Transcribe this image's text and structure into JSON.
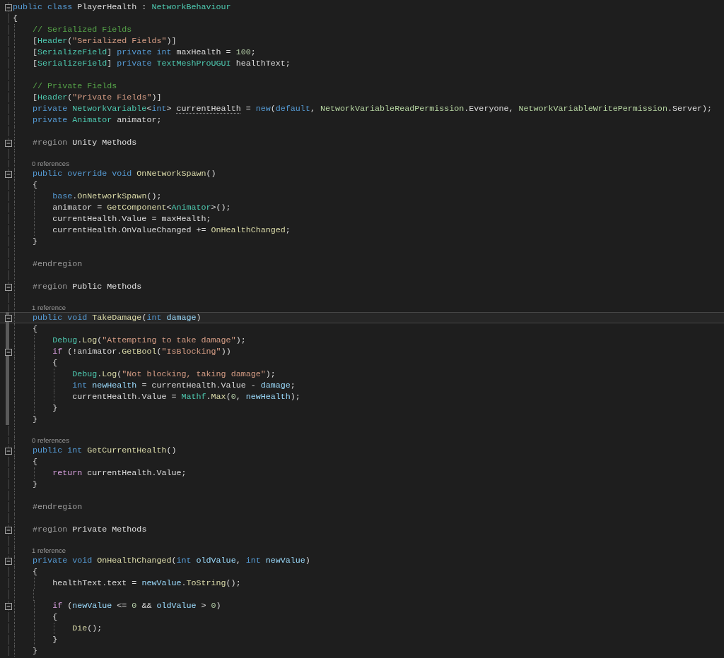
{
  "editor": {
    "lines": [
      {
        "kind": "code",
        "selected": false,
        "foldable": true,
        "changed": false,
        "tokens": [
          {
            "kind": "keyword",
            "text": "public class"
          },
          {
            "kind": "plain",
            "text": " PlayerHealth : "
          },
          {
            "kind": "type",
            "text": "NetworkBehaviour"
          }
        ]
      },
      {
        "kind": "code",
        "selected": false,
        "foldable": false,
        "changed": false,
        "tokens": [
          {
            "kind": "plain",
            "text": "{"
          }
        ]
      },
      {
        "kind": "code",
        "selected": false,
        "foldable": false,
        "changed": false,
        "tokens": [
          {
            "kind": "comment",
            "text": "    // Serialized Fields"
          }
        ]
      },
      {
        "kind": "code",
        "selected": false,
        "foldable": false,
        "changed": false,
        "tokens": [
          {
            "kind": "plain",
            "text": "    ["
          },
          {
            "kind": "type",
            "text": "Header"
          },
          {
            "kind": "plain",
            "text": "("
          },
          {
            "kind": "string",
            "text": "\"Serialized Fields\""
          },
          {
            "kind": "plain",
            "text": ")]"
          }
        ]
      },
      {
        "kind": "code",
        "selected": false,
        "foldable": false,
        "changed": false,
        "tokens": [
          {
            "kind": "plain",
            "text": "    ["
          },
          {
            "kind": "type",
            "text": "SerializeField"
          },
          {
            "kind": "plain",
            "text": "] "
          },
          {
            "kind": "keyword",
            "text": "private int"
          },
          {
            "kind": "plain",
            "text": " maxHealth = "
          },
          {
            "kind": "number",
            "text": "100"
          },
          {
            "kind": "plain",
            "text": ";"
          }
        ]
      },
      {
        "kind": "code",
        "selected": false,
        "foldable": false,
        "changed": false,
        "tokens": [
          {
            "kind": "plain",
            "text": "    ["
          },
          {
            "kind": "type",
            "text": "SerializeField"
          },
          {
            "kind": "plain",
            "text": "] "
          },
          {
            "kind": "keyword",
            "text": "private "
          },
          {
            "kind": "type",
            "text": "TextMeshProUGUI"
          },
          {
            "kind": "plain",
            "text": " healthText;"
          }
        ]
      },
      {
        "kind": "blank",
        "selected": false,
        "foldable": false,
        "changed": false
      },
      {
        "kind": "code",
        "selected": false,
        "foldable": false,
        "changed": false,
        "tokens": [
          {
            "kind": "comment",
            "text": "    // Private Fields"
          }
        ]
      },
      {
        "kind": "code",
        "selected": false,
        "foldable": false,
        "changed": false,
        "tokens": [
          {
            "kind": "plain",
            "text": "    ["
          },
          {
            "kind": "type",
            "text": "Header"
          },
          {
            "kind": "plain",
            "text": "("
          },
          {
            "kind": "string",
            "text": "\"Private Fields\""
          },
          {
            "kind": "plain",
            "text": ")]"
          }
        ]
      },
      {
        "kind": "code",
        "selected": false,
        "foldable": false,
        "changed": false,
        "tokens": [
          {
            "kind": "keyword",
            "text": "    private "
          },
          {
            "kind": "type",
            "text": "NetworkVariable"
          },
          {
            "kind": "plain",
            "text": "<"
          },
          {
            "kind": "keyword",
            "text": "int"
          },
          {
            "kind": "plain",
            "text": "> "
          },
          {
            "kind": "suggested",
            "text": "currentHealth"
          },
          {
            "kind": "plain",
            "text": " = "
          },
          {
            "kind": "keyword",
            "text": "new"
          },
          {
            "kind": "plain",
            "text": "("
          },
          {
            "kind": "keyword",
            "text": "default"
          },
          {
            "kind": "plain",
            "text": ", "
          },
          {
            "kind": "enum",
            "text": "NetworkVariableReadPermission"
          },
          {
            "kind": "plain",
            "text": ".Everyone, "
          },
          {
            "kind": "enum",
            "text": "NetworkVariableWritePermission"
          },
          {
            "kind": "plain",
            "text": ".Server);"
          }
        ]
      },
      {
        "kind": "code",
        "selected": false,
        "foldable": false,
        "changed": false,
        "tokens": [
          {
            "kind": "keyword",
            "text": "    private "
          },
          {
            "kind": "type",
            "text": "Animator"
          },
          {
            "kind": "plain",
            "text": " animator;"
          }
        ]
      },
      {
        "kind": "blank",
        "selected": false,
        "foldable": false,
        "changed": false
      },
      {
        "kind": "code",
        "selected": false,
        "foldable": true,
        "changed": false,
        "tokens": [
          {
            "kind": "preprocessor",
            "text": "    #region"
          },
          {
            "kind": "region",
            "text": " Unity Methods"
          }
        ]
      },
      {
        "kind": "blank",
        "selected": false,
        "foldable": false,
        "changed": false
      },
      {
        "kind": "codelens",
        "selected": false,
        "foldable": false,
        "changed": false,
        "text": "0 references"
      },
      {
        "kind": "code",
        "selected": false,
        "foldable": true,
        "changed": false,
        "tokens": [
          {
            "kind": "keyword",
            "text": "    public override void"
          },
          {
            "kind": "method",
            "text": " OnNetworkSpawn"
          },
          {
            "kind": "plain",
            "text": "()"
          }
        ]
      },
      {
        "kind": "code",
        "selected": false,
        "foldable": false,
        "changed": false,
        "tokens": [
          {
            "kind": "plain",
            "text": "    {"
          }
        ]
      },
      {
        "kind": "code",
        "selected": false,
        "foldable": false,
        "changed": false,
        "tokens": [
          {
            "kind": "keyword",
            "text": "        base"
          },
          {
            "kind": "plain",
            "text": "."
          },
          {
            "kind": "method",
            "text": "OnNetworkSpawn"
          },
          {
            "kind": "plain",
            "text": "();"
          }
        ]
      },
      {
        "kind": "code",
        "selected": false,
        "foldable": false,
        "changed": false,
        "tokens": [
          {
            "kind": "plain",
            "text": "        animator = "
          },
          {
            "kind": "method",
            "text": "GetComponent"
          },
          {
            "kind": "plain",
            "text": "<"
          },
          {
            "kind": "type",
            "text": "Animator"
          },
          {
            "kind": "plain",
            "text": ">();"
          }
        ]
      },
      {
        "kind": "code",
        "selected": false,
        "foldable": false,
        "changed": false,
        "tokens": [
          {
            "kind": "plain",
            "text": "        currentHealth.Value = maxHealth;"
          }
        ]
      },
      {
        "kind": "code",
        "selected": false,
        "foldable": false,
        "changed": false,
        "tokens": [
          {
            "kind": "plain",
            "text": "        currentHealth.OnValueChanged += "
          },
          {
            "kind": "method",
            "text": "OnHealthChanged"
          },
          {
            "kind": "plain",
            "text": ";"
          }
        ]
      },
      {
        "kind": "code",
        "selected": false,
        "foldable": false,
        "changed": false,
        "tokens": [
          {
            "kind": "plain",
            "text": "    }"
          }
        ]
      },
      {
        "kind": "blank",
        "selected": false,
        "foldable": false,
        "changed": false
      },
      {
        "kind": "code",
        "selected": false,
        "foldable": false,
        "changed": false,
        "tokens": [
          {
            "kind": "preprocessor",
            "text": "    #endregion"
          }
        ]
      },
      {
        "kind": "blank",
        "selected": false,
        "foldable": false,
        "changed": false
      },
      {
        "kind": "code",
        "selected": false,
        "foldable": true,
        "changed": false,
        "tokens": [
          {
            "kind": "preprocessor",
            "text": "    #region"
          },
          {
            "kind": "region",
            "text": " Public Methods"
          }
        ]
      },
      {
        "kind": "blank",
        "selected": false,
        "foldable": false,
        "changed": false
      },
      {
        "kind": "codelens",
        "selected": false,
        "foldable": false,
        "changed": false,
        "text": "1 reference"
      },
      {
        "kind": "code",
        "selected": true,
        "foldable": true,
        "changed": true,
        "tokens": [
          {
            "kind": "keyword",
            "text": "    public void"
          },
          {
            "kind": "method",
            "text": " TakeDamage"
          },
          {
            "kind": "plain",
            "text": "("
          },
          {
            "kind": "keyword",
            "text": "int "
          },
          {
            "kind": "variable",
            "text": "damage"
          },
          {
            "kind": "plain",
            "text": ")"
          }
        ]
      },
      {
        "kind": "code",
        "selected": false,
        "foldable": false,
        "changed": true,
        "tokens": [
          {
            "kind": "plain",
            "text": "    {"
          }
        ]
      },
      {
        "kind": "code",
        "selected": false,
        "foldable": false,
        "changed": true,
        "tokens": [
          {
            "kind": "type",
            "text": "        Debug"
          },
          {
            "kind": "plain",
            "text": "."
          },
          {
            "kind": "method",
            "text": "Log"
          },
          {
            "kind": "plain",
            "text": "("
          },
          {
            "kind": "string",
            "text": "\"Attempting to take damage\""
          },
          {
            "kind": "plain",
            "text": ");"
          }
        ]
      },
      {
        "kind": "code",
        "selected": false,
        "foldable": true,
        "changed": true,
        "tokens": [
          {
            "kind": "control",
            "text": "        if"
          },
          {
            "kind": "plain",
            "text": " (!animator."
          },
          {
            "kind": "method",
            "text": "GetBool"
          },
          {
            "kind": "plain",
            "text": "("
          },
          {
            "kind": "string",
            "text": "\"IsBlocking\""
          },
          {
            "kind": "plain",
            "text": "))"
          }
        ]
      },
      {
        "kind": "code",
        "selected": false,
        "foldable": false,
        "changed": true,
        "tokens": [
          {
            "kind": "plain",
            "text": "        {"
          }
        ]
      },
      {
        "kind": "code",
        "selected": false,
        "foldable": false,
        "changed": true,
        "tokens": [
          {
            "kind": "type",
            "text": "            Debug"
          },
          {
            "kind": "plain",
            "text": "."
          },
          {
            "kind": "method",
            "text": "Log"
          },
          {
            "kind": "plain",
            "text": "("
          },
          {
            "kind": "string",
            "text": "\"Not blocking, taking damage\""
          },
          {
            "kind": "plain",
            "text": ");"
          }
        ]
      },
      {
        "kind": "code",
        "selected": false,
        "foldable": false,
        "changed": true,
        "tokens": [
          {
            "kind": "keyword",
            "text": "            int "
          },
          {
            "kind": "variable",
            "text": "newHealth"
          },
          {
            "kind": "plain",
            "text": " = currentHealth.Value - "
          },
          {
            "kind": "variable",
            "text": "damage"
          },
          {
            "kind": "plain",
            "text": ";"
          }
        ]
      },
      {
        "kind": "code",
        "selected": false,
        "foldable": false,
        "changed": true,
        "tokens": [
          {
            "kind": "plain",
            "text": "            currentHealth.Value = "
          },
          {
            "kind": "type",
            "text": "Mathf"
          },
          {
            "kind": "plain",
            "text": "."
          },
          {
            "kind": "method",
            "text": "Max"
          },
          {
            "kind": "plain",
            "text": "("
          },
          {
            "kind": "number",
            "text": "0"
          },
          {
            "kind": "plain",
            "text": ", "
          },
          {
            "kind": "variable",
            "text": "newHealth"
          },
          {
            "kind": "plain",
            "text": ");"
          }
        ]
      },
      {
        "kind": "code",
        "selected": false,
        "foldable": false,
        "changed": true,
        "tokens": [
          {
            "kind": "plain",
            "text": "        }"
          }
        ]
      },
      {
        "kind": "code",
        "selected": false,
        "foldable": false,
        "changed": true,
        "tokens": [
          {
            "kind": "plain",
            "text": "    }"
          }
        ]
      },
      {
        "kind": "blank",
        "selected": false,
        "foldable": false,
        "changed": false
      },
      {
        "kind": "codelens",
        "selected": false,
        "foldable": false,
        "changed": false,
        "text": "0 references"
      },
      {
        "kind": "code",
        "selected": false,
        "foldable": true,
        "changed": false,
        "tokens": [
          {
            "kind": "keyword",
            "text": "    public int"
          },
          {
            "kind": "method",
            "text": " GetCurrentHealth"
          },
          {
            "kind": "plain",
            "text": "()"
          }
        ]
      },
      {
        "kind": "code",
        "selected": false,
        "foldable": false,
        "changed": false,
        "tokens": [
          {
            "kind": "plain",
            "text": "    {"
          }
        ]
      },
      {
        "kind": "code",
        "selected": false,
        "foldable": false,
        "changed": false,
        "tokens": [
          {
            "kind": "control",
            "text": "        return"
          },
          {
            "kind": "plain",
            "text": " currentHealth.Value;"
          }
        ]
      },
      {
        "kind": "code",
        "selected": false,
        "foldable": false,
        "changed": false,
        "tokens": [
          {
            "kind": "plain",
            "text": "    }"
          }
        ]
      },
      {
        "kind": "blank",
        "selected": false,
        "foldable": false,
        "changed": false
      },
      {
        "kind": "code",
        "selected": false,
        "foldable": false,
        "changed": false,
        "tokens": [
          {
            "kind": "preprocessor",
            "text": "    #endregion"
          }
        ]
      },
      {
        "kind": "blank",
        "selected": false,
        "foldable": false,
        "changed": false
      },
      {
        "kind": "code",
        "selected": false,
        "foldable": true,
        "changed": false,
        "tokens": [
          {
            "kind": "preprocessor",
            "text": "    #region"
          },
          {
            "kind": "region",
            "text": " Private Methods"
          }
        ]
      },
      {
        "kind": "blank",
        "selected": false,
        "foldable": false,
        "changed": false
      },
      {
        "kind": "codelens",
        "selected": false,
        "foldable": false,
        "changed": false,
        "text": "1 reference"
      },
      {
        "kind": "code",
        "selected": false,
        "foldable": true,
        "changed": false,
        "tokens": [
          {
            "kind": "keyword",
            "text": "    private void"
          },
          {
            "kind": "method",
            "text": " OnHealthChanged"
          },
          {
            "kind": "plain",
            "text": "("
          },
          {
            "kind": "keyword",
            "text": "int "
          },
          {
            "kind": "variable",
            "text": "oldValue"
          },
          {
            "kind": "plain",
            "text": ", "
          },
          {
            "kind": "keyword",
            "text": "int "
          },
          {
            "kind": "variable",
            "text": "newValue"
          },
          {
            "kind": "plain",
            "text": ")"
          }
        ]
      },
      {
        "kind": "code",
        "selected": false,
        "foldable": false,
        "changed": false,
        "tokens": [
          {
            "kind": "plain",
            "text": "    {"
          }
        ]
      },
      {
        "kind": "code",
        "selected": false,
        "foldable": false,
        "changed": false,
        "tokens": [
          {
            "kind": "plain",
            "text": "        healthText.text = "
          },
          {
            "kind": "variable",
            "text": "newValue"
          },
          {
            "kind": "plain",
            "text": "."
          },
          {
            "kind": "method",
            "text": "ToString"
          },
          {
            "kind": "plain",
            "text": "();"
          }
        ]
      },
      {
        "kind": "blank",
        "selected": false,
        "foldable": false,
        "changed": false
      },
      {
        "kind": "code",
        "selected": false,
        "foldable": true,
        "changed": false,
        "tokens": [
          {
            "kind": "control",
            "text": "        if"
          },
          {
            "kind": "plain",
            "text": " ("
          },
          {
            "kind": "variable",
            "text": "newValue"
          },
          {
            "kind": "plain",
            "text": " <= "
          },
          {
            "kind": "number",
            "text": "0"
          },
          {
            "kind": "plain",
            "text": " && "
          },
          {
            "kind": "variable",
            "text": "oldValue"
          },
          {
            "kind": "plain",
            "text": " > "
          },
          {
            "kind": "number",
            "text": "0"
          },
          {
            "kind": "plain",
            "text": ")"
          }
        ]
      },
      {
        "kind": "code",
        "selected": false,
        "foldable": false,
        "changed": false,
        "tokens": [
          {
            "kind": "plain",
            "text": "        {"
          }
        ]
      },
      {
        "kind": "code",
        "selected": false,
        "foldable": false,
        "changed": false,
        "tokens": [
          {
            "kind": "method",
            "text": "            Die"
          },
          {
            "kind": "plain",
            "text": "();"
          }
        ]
      },
      {
        "kind": "code",
        "selected": false,
        "foldable": false,
        "changed": false,
        "tokens": [
          {
            "kind": "plain",
            "text": "        }"
          }
        ]
      },
      {
        "kind": "code",
        "selected": false,
        "foldable": false,
        "changed": false,
        "tokens": [
          {
            "kind": "plain",
            "text": "    }"
          }
        ]
      }
    ]
  }
}
